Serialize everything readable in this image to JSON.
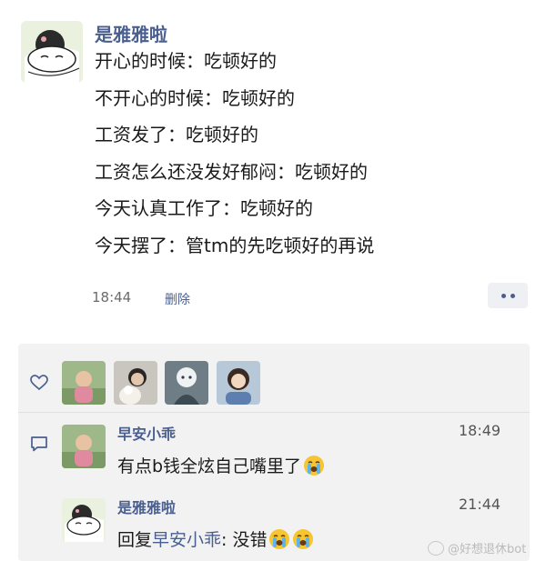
{
  "post": {
    "author": "是雅雅啦",
    "lines": [
      "开心的时候：吃顿好的",
      "不开心的时候：吃顿好的",
      "工资发了：吃顿好的",
      "工资怎么还没发好郁闷：吃顿好的",
      "今天认真工作了：吃顿好的",
      "今天摆了：管tm的先吃顿好的再说"
    ],
    "time": "18:44",
    "delete_label": "删除"
  },
  "likes": {
    "icon": "heart-icon",
    "avatars": [
      "liker-1",
      "liker-2",
      "liker-3",
      "liker-4"
    ]
  },
  "comments": [
    {
      "name": "早安小乖",
      "time": "18:49",
      "text": "有点b钱全炫自己嘴里了",
      "emoji": "loudly-crying-face"
    },
    {
      "name": "是雅雅啦",
      "time": "21:44",
      "reply_prefix": "回复",
      "reply_to": "早安小乖",
      "text": ": 没错",
      "emoji_count": 2
    }
  ],
  "watermark": "@好想退休bot",
  "colors": {
    "link": "#4a5f8f",
    "panel": "#f2f2f2"
  }
}
